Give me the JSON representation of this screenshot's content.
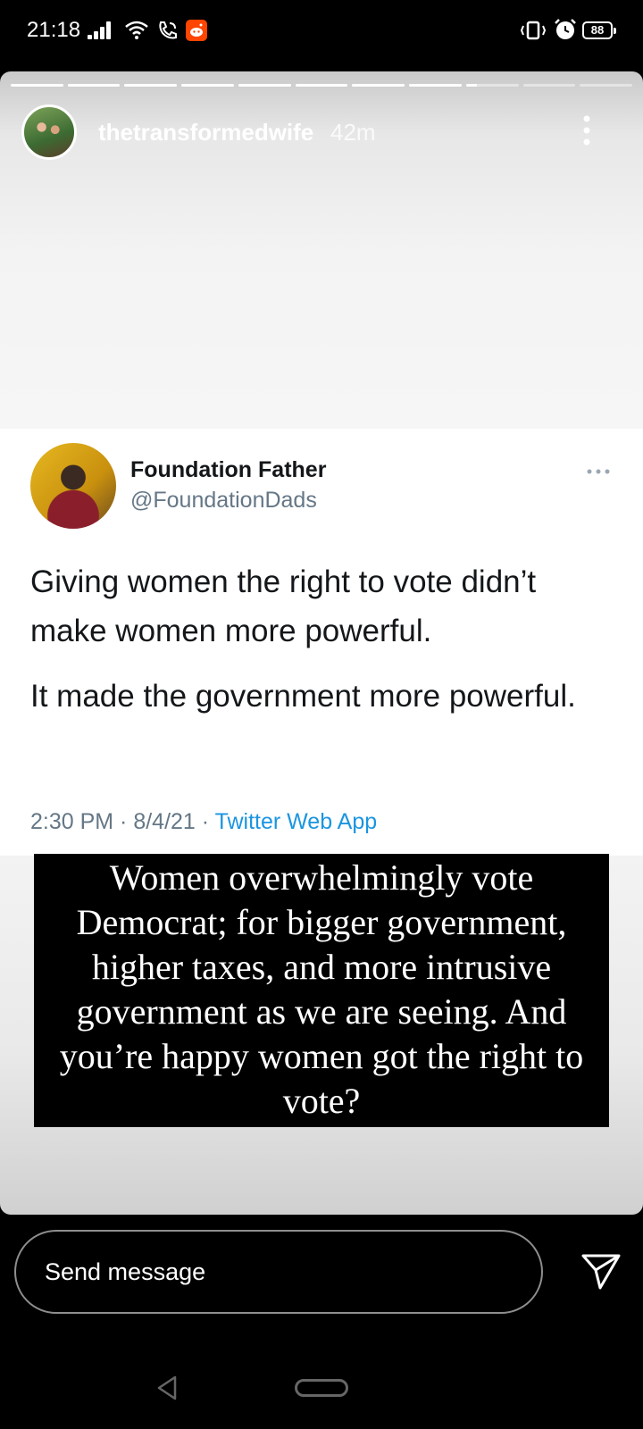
{
  "status_bar": {
    "time": "21:18",
    "battery": "88",
    "icons": [
      "signal-icon",
      "wifi-icon",
      "wifi-call-icon",
      "reddit-icon",
      "vibrate-icon",
      "alarm-icon",
      "battery-icon"
    ]
  },
  "story": {
    "username": "thetransformedwife",
    "age": "42m",
    "progress": {
      "segments": 11,
      "completed": 8,
      "current_fraction": 0.2
    }
  },
  "tweet": {
    "display_name": "Foundation Father",
    "handle": "@FoundationDads",
    "text_1": "Giving women the right to vote didn’t make women more powerful.",
    "text_2": "It made the government more powerful.",
    "time_date": "2:30 PM · 8/4/21 · ",
    "client": "Twitter Web App"
  },
  "caption": {
    "text": "Women overwhelmingly vote Democrat; for bigger government, higher taxes, and more intrusive government as we are seeing. And you’re happy women got the right to vote?"
  },
  "reply": {
    "placeholder": "Send message"
  },
  "colors": {
    "twitter_blue": "#1b95e0",
    "twitter_gray": "#657786",
    "reddit_orange": "#ff4500"
  }
}
